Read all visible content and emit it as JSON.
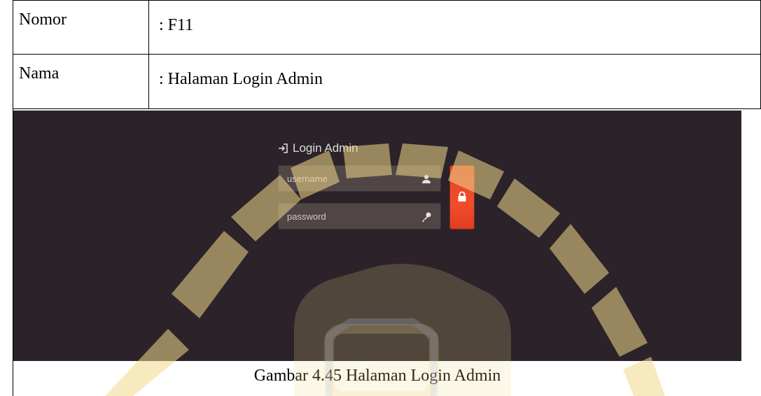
{
  "table": {
    "rows": [
      {
        "label": "Nomor",
        "value": ": F11"
      },
      {
        "label": "Nama",
        "value": ": Halaman Login Admin"
      }
    ]
  },
  "login": {
    "heading": "Login Admin",
    "username_placeholder": "username",
    "password_placeholder": "password",
    "button_color": "#f04e2b",
    "heading_icon": "sign-in-icon",
    "username_icon": "user-icon",
    "password_icon": "key-icon",
    "button_icon": "lock-icon"
  },
  "caption": "Gambar 4.45 Halaman Login Admin",
  "colors": {
    "screenshot_bg": "#2b2329",
    "field_bg": "#504646",
    "watermark": "#f2d98a"
  }
}
